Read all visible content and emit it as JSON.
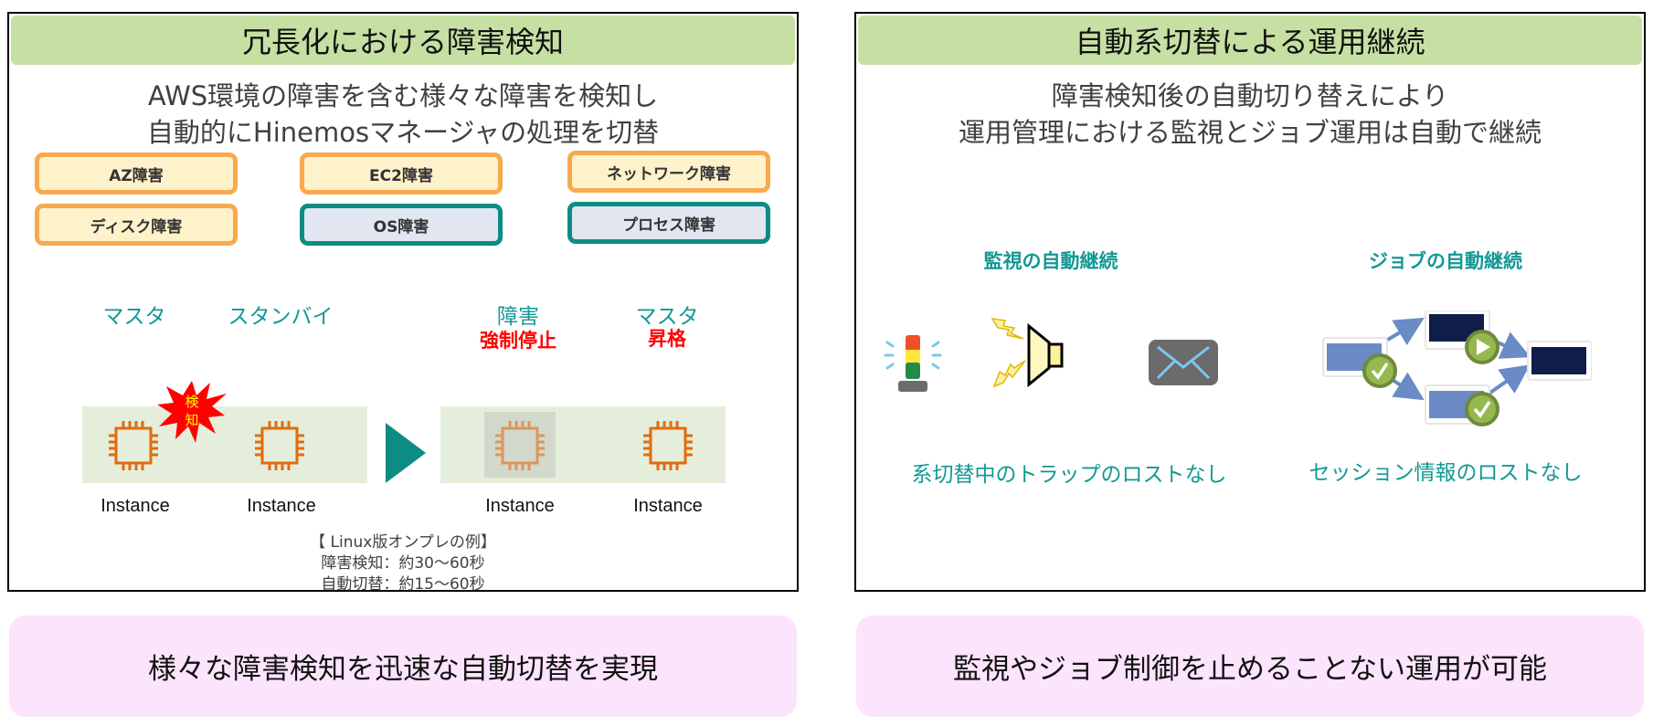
{
  "left_panel": {
    "title": "冗長化における障害検知",
    "subtitle_line1": "AWS環境の障害を含む様々な障害を検知し",
    "subtitle_line2": "自動的にHinemosマネージャの処理を切替",
    "failure_types": [
      {
        "label": "AZ障害",
        "style": "orange"
      },
      {
        "label": "EC2障害",
        "style": "orange"
      },
      {
        "label": "ネットワーク障害",
        "style": "orange"
      },
      {
        "label": "ディスク障害",
        "style": "orange"
      },
      {
        "label": "OS障害",
        "style": "teal"
      },
      {
        "label": "プロセス障害",
        "style": "teal"
      }
    ],
    "before": {
      "nodes": [
        {
          "role": "マスタ",
          "label": "Instance",
          "badge": "検知"
        },
        {
          "role": "スタンバイ",
          "label": "Instance"
        }
      ]
    },
    "after": {
      "nodes": [
        {
          "role": "障害",
          "action": "強制停止",
          "label": "Instance",
          "state": "stopped"
        },
        {
          "role": "マスタ",
          "action": "昇格",
          "label": "Instance",
          "state": "active"
        }
      ]
    },
    "note_lines": [
      "【 Linux版オンプレの例】",
      "障害検知：約30～60秒",
      "自動切替：約15～60秒"
    ]
  },
  "right_panel": {
    "title": "自動系切替による運用継続",
    "subtitle_line1": "障害検知後の自動切り替えにより",
    "subtitle_line2": "運用管理における監視とジョブ運用は自動で継続",
    "sections": [
      {
        "title": "監視の自動継続",
        "note": "系切替中のトラップのロストなし",
        "icons": [
          "signal-tower-icon",
          "speaker-alert-icon",
          "mail-icon"
        ]
      },
      {
        "title": "ジョブの自動継続",
        "note": "セッション情報のロストなし",
        "icons": [
          "job-flow-icon"
        ]
      }
    ]
  },
  "bottom": {
    "left": "様々な障害検知を迅速な自動切替を実現",
    "right": "監視やジョブ制御を止めることない運用が可能"
  },
  "colors": {
    "header_green": "#c6e0a4",
    "teal": "#139895",
    "orange_border": "#f8a94f",
    "orange_fill": "#fef2cb",
    "teal_border": "#0c8c84",
    "teal_fill": "#e1e6f1",
    "alert_red": "#ff0000",
    "chip_orange": "#e06c10",
    "band_green": "#e5eedb",
    "bottom_pink": "#fde4fd"
  }
}
